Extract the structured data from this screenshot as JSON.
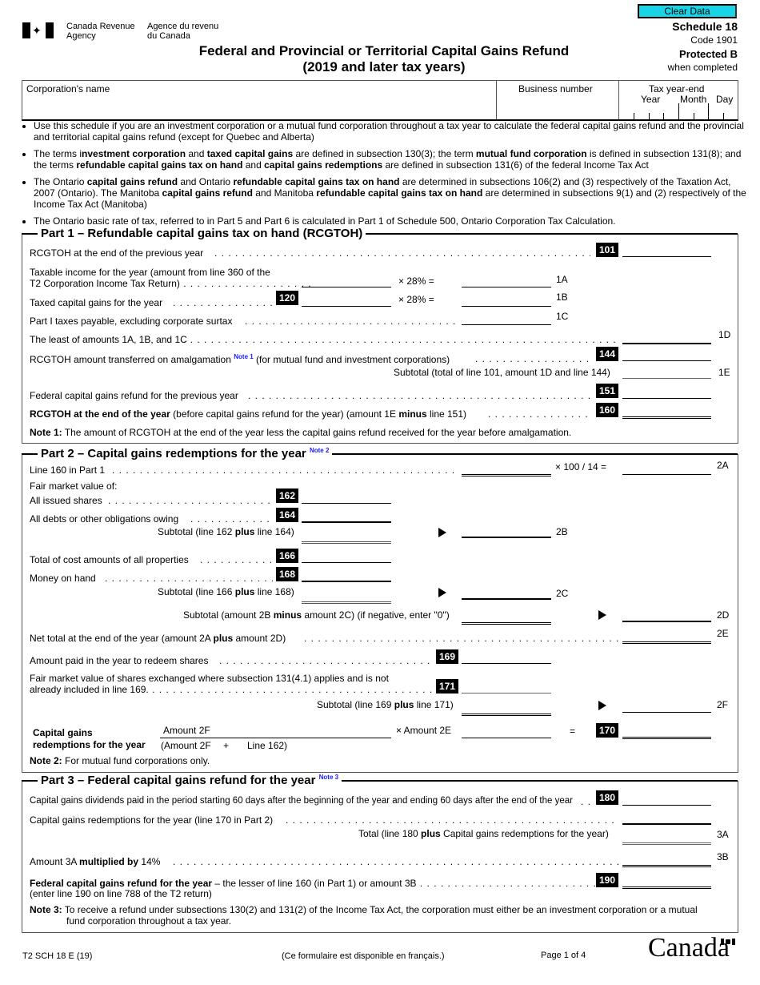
{
  "header": {
    "agency_en_1": "Canada Revenue",
    "agency_en_2": "Agency",
    "agency_fr_1": "Agence du revenu",
    "agency_fr_2": "du Canada",
    "title_1": "Federal and Provincial or Territorial Capital Gains Refund",
    "title_2": "(2019 and later tax years)",
    "clear_button": "Clear Data",
    "schedule": "Schedule 18",
    "code": "Code 1901",
    "protected": "Protected B",
    "when_completed": "when completed",
    "clear_button_color": "#19d3e6"
  },
  "id_box": {
    "corp_name_label": "Corporation's name",
    "corp_name_value": "",
    "business_number_label": "Business number",
    "business_number_value": "",
    "tax_year_end_label": "Tax year-end",
    "year_label": "Year",
    "month_label": "Month",
    "day_label": "Day"
  },
  "bullets": [
    {
      "html": "Use this schedule if you are an investment corporation or a mutual fund corporation throughout a tax year to calculate the federal capital gains refund and the provincial and territorial capital gains refund (except for Quebec and Alberta)"
    },
    {
      "html": "The terms i<b>nvestment corporation</b> and <b>taxed capital gains</b> are defined in subsection 130(3); the term <b>mutual fund corporation</b> is defined in subsection 131(8); and the terms <b>refundable capital gains tax on hand</b> and <b>capital gains redemptions</b> are defined in subsection 131(6) of the federal Income Tax Act"
    },
    {
      "html": "The Ontario <b>capital gains refund</b> and Ontario <b>refundable capital gains tax on hand</b> are determined in subsections 106(2) and (3) respectively of the Taxation Act, 2007 (Ontario). The Manitoba <b>capital gains refund</b> and Manitoba <b>refundable capital gains tax on hand</b> are determined in subsections 9(1) and (2) respectively of the Income Tax Act (Manitoba)"
    },
    {
      "html": "The Ontario basic rate of tax, referred to in Part 5 and Part 6 is calculated in Part 1 of Schedule 500, Ontario Corporation Tax Calculation."
    }
  ],
  "part1": {
    "title": "Part 1 – Refundable capital gains tax on hand (RCGTOH)",
    "r101": "RCGTOH at the end of the previous year",
    "c101": "101",
    "taxable_1": "Taxable income for the year (amount from line 360 of the",
    "taxable_2": "T2 Corporation Income Tax Return)",
    "mult_1a": "×   28%   =",
    "l1a": "1A",
    "r120": "Taxed capital gains for the year",
    "c120": "120",
    "mult_1b": "×   28%   =",
    "l1b": "1B",
    "part1tax": "Part I taxes payable, excluding corporate surtax",
    "l1c": "1C",
    "least": "The least of amounts 1A, 1B, and 1C",
    "l1d": "1D",
    "r144_a": "RCGTOH amount transferred on amalgamation",
    "note1_ref": "Note 1",
    "r144_b": "(for mutual fund and investment corporations)",
    "c144": "144",
    "subtotal_1e": "Subtotal (total of line 101, amount 1D and line 144)",
    "l1e": "1E",
    "r151": "Federal capital gains refund for the previous year",
    "c151": "151",
    "r160_bold": "RCGTOH at the end of the year",
    "r160_rest_a": " (before capital gains refund for the year) (amount 1E ",
    "r160_minus": "minus",
    "r160_rest_b": " line 151)",
    "c160": "160",
    "note1_label": "Note 1:",
    "note1_text": " The amount of RCGTOH at the end of the year less the capital gains refund received for the year before amalgamation."
  },
  "part2": {
    "title": "Part 2 – Capital gains redemptions for the year",
    "note2_ref": "Note 2",
    "line160": "Line 160 in Part 1",
    "mult_2a": "× 100 / 14  =",
    "l2a": "2A",
    "fmv": "Fair market value of:",
    "r162": "All issued shares",
    "c162": "162",
    "r164": "All debts or other obligations owing",
    "c164": "164",
    "sub_2b_a": "Subtotal (line 162 ",
    "plus": "plus",
    "sub_2b_b": " line 164)",
    "l2b": "2B",
    "r166": "Total of cost amounts of all properties",
    "c166": "166",
    "r168": "Money on hand",
    "c168": "168",
    "sub_2c_a": "Subtotal (line 166 ",
    "sub_2c_b": " line 168)",
    "l2c": "2C",
    "sub_2d_a": "Subtotal (amount 2B ",
    "minus": "minus",
    "sub_2d_b": " amount 2C) (if negative, enter \"0\")",
    "l2d": "2D",
    "net_a": "Net total at the end of the year (amount 2A ",
    "net_b": " amount 2D)",
    "l2e": "2E",
    "r169": "Amount paid in the year to redeem shares",
    "c169": "169",
    "r171_1": "Fair market value of shares exchanged where subsection 131(4.1) applies and is not",
    "r171_2": "already included in line 169.",
    "c171": "171",
    "sub_2f_a": "Subtotal (line 169 ",
    "sub_2f_b": " line 171)",
    "l2f": "2F",
    "cgr_1": "Capital gains",
    "cgr_2": "redemptions for the year",
    "amount2f": "Amount 2F",
    "denominator_a": "(Amount 2F",
    "denominator_plus": "+",
    "denominator_b": "Line 162)",
    "times_2e": "× Amount 2E",
    "equals": "=",
    "c170": "170",
    "note2_label": "Note 2:",
    "note2_text": " For mutual fund corporations only."
  },
  "part3": {
    "title": "Part 3 – Federal capital gains refund for the year",
    "note3_ref": "Note 3",
    "r180": "Capital gains dividends paid in the period starting 60 days after the beginning of the year and ending 60 days after the end of the year",
    "c180": "180",
    "cgr": "Capital gains redemptions for the year (line 170 in Part 2)",
    "total_a": "Total (line 180 ",
    "plus": "plus",
    "total_b": " Capital gains redemptions for the year)",
    "l3a": "3A",
    "mult_a": "Amount 3A ",
    "mult_bold": "multiplied by",
    "mult_b": " 14%",
    "l3b": "3B",
    "r190_bold": "Federal capital gains refund for the year",
    "r190_rest": " – the lesser of line 160 (in Part 1) or amount 3B",
    "r190_2": "(enter line 190 on line 788 of the T2 return)",
    "c190": "190",
    "note3_label": "Note 3:",
    "note3_text_1": " To receive a refund under subsections 130(2) and 131(2) of the Income Tax Act, the corporation must either be an investment corporation or a mutual",
    "note3_text_2": "fund corporation throughout a tax year."
  },
  "footer": {
    "form_code": "T2 SCH 18 E (19)",
    "french": "(Ce formulaire est disponible en français.)",
    "page": "Page 1 of 4",
    "wordmark": "Canada"
  }
}
